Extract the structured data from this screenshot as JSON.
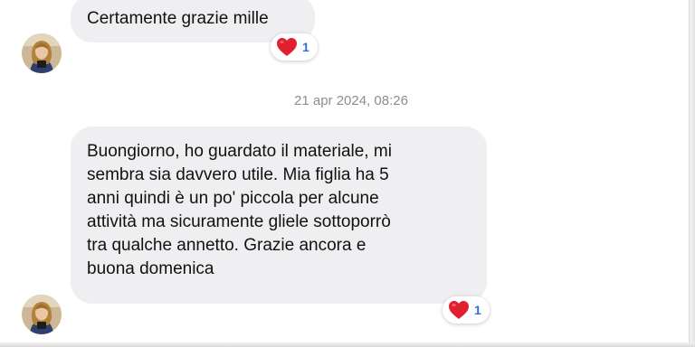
{
  "messages": [
    {
      "text": "Certamente grazie mille",
      "reaction": {
        "emoji": "heart-icon",
        "count": "1"
      }
    },
    {
      "lines": [
        "Buongiorno, ho guardato il materiale, mi",
        "sembra sia davvero utile. Mia figlia ha 5",
        "anni quindi è un po' piccola per alcune",
        "attività ma sicuramente gliele sottoporrò",
        "tra qualche annetto. Grazie ancora e",
        "buona domenica"
      ],
      "reaction": {
        "emoji": "heart-icon",
        "count": "1"
      }
    }
  ],
  "timestamp": "21 apr 2024, 08:26",
  "colors": {
    "bubble": "#efeff1",
    "text": "#111111",
    "timestamp": "#8d8d93",
    "reaction_count": "#2f6fdc",
    "heart": "#e0202e"
  }
}
